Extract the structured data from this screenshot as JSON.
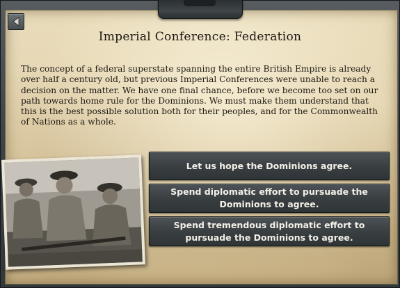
{
  "event": {
    "title": "Imperial Conference: Federation",
    "description": "The concept of a federal superstate spanning the entire British Empire is already over half a century old, but previous Imperial Conferences were unable to reach a decision on the matter. We have one final chance, before we become too set on our path towards home rule for the Dominions. We must make them understand that this is the best possible solution both for their peoples, and for the Commonwealth of Nations as a whole.",
    "photo": "sepia photograph of smiling soldiers in helmets seated with rifles"
  },
  "options": [
    {
      "label": "Let us hope the Dominions agree."
    },
    {
      "label": "Spend diplomatic effort to pursuade the Dominions to agree."
    },
    {
      "label": "Spend tremendous diplomatic effort to pursuade the Dominions to agree."
    }
  ],
  "icons": {
    "back": "back-arrow-icon"
  },
  "colors": {
    "parchment": "#e3d3ae",
    "frame": "#3e4448",
    "button": "#3a3f42",
    "button_text": "#f3f0e8"
  }
}
